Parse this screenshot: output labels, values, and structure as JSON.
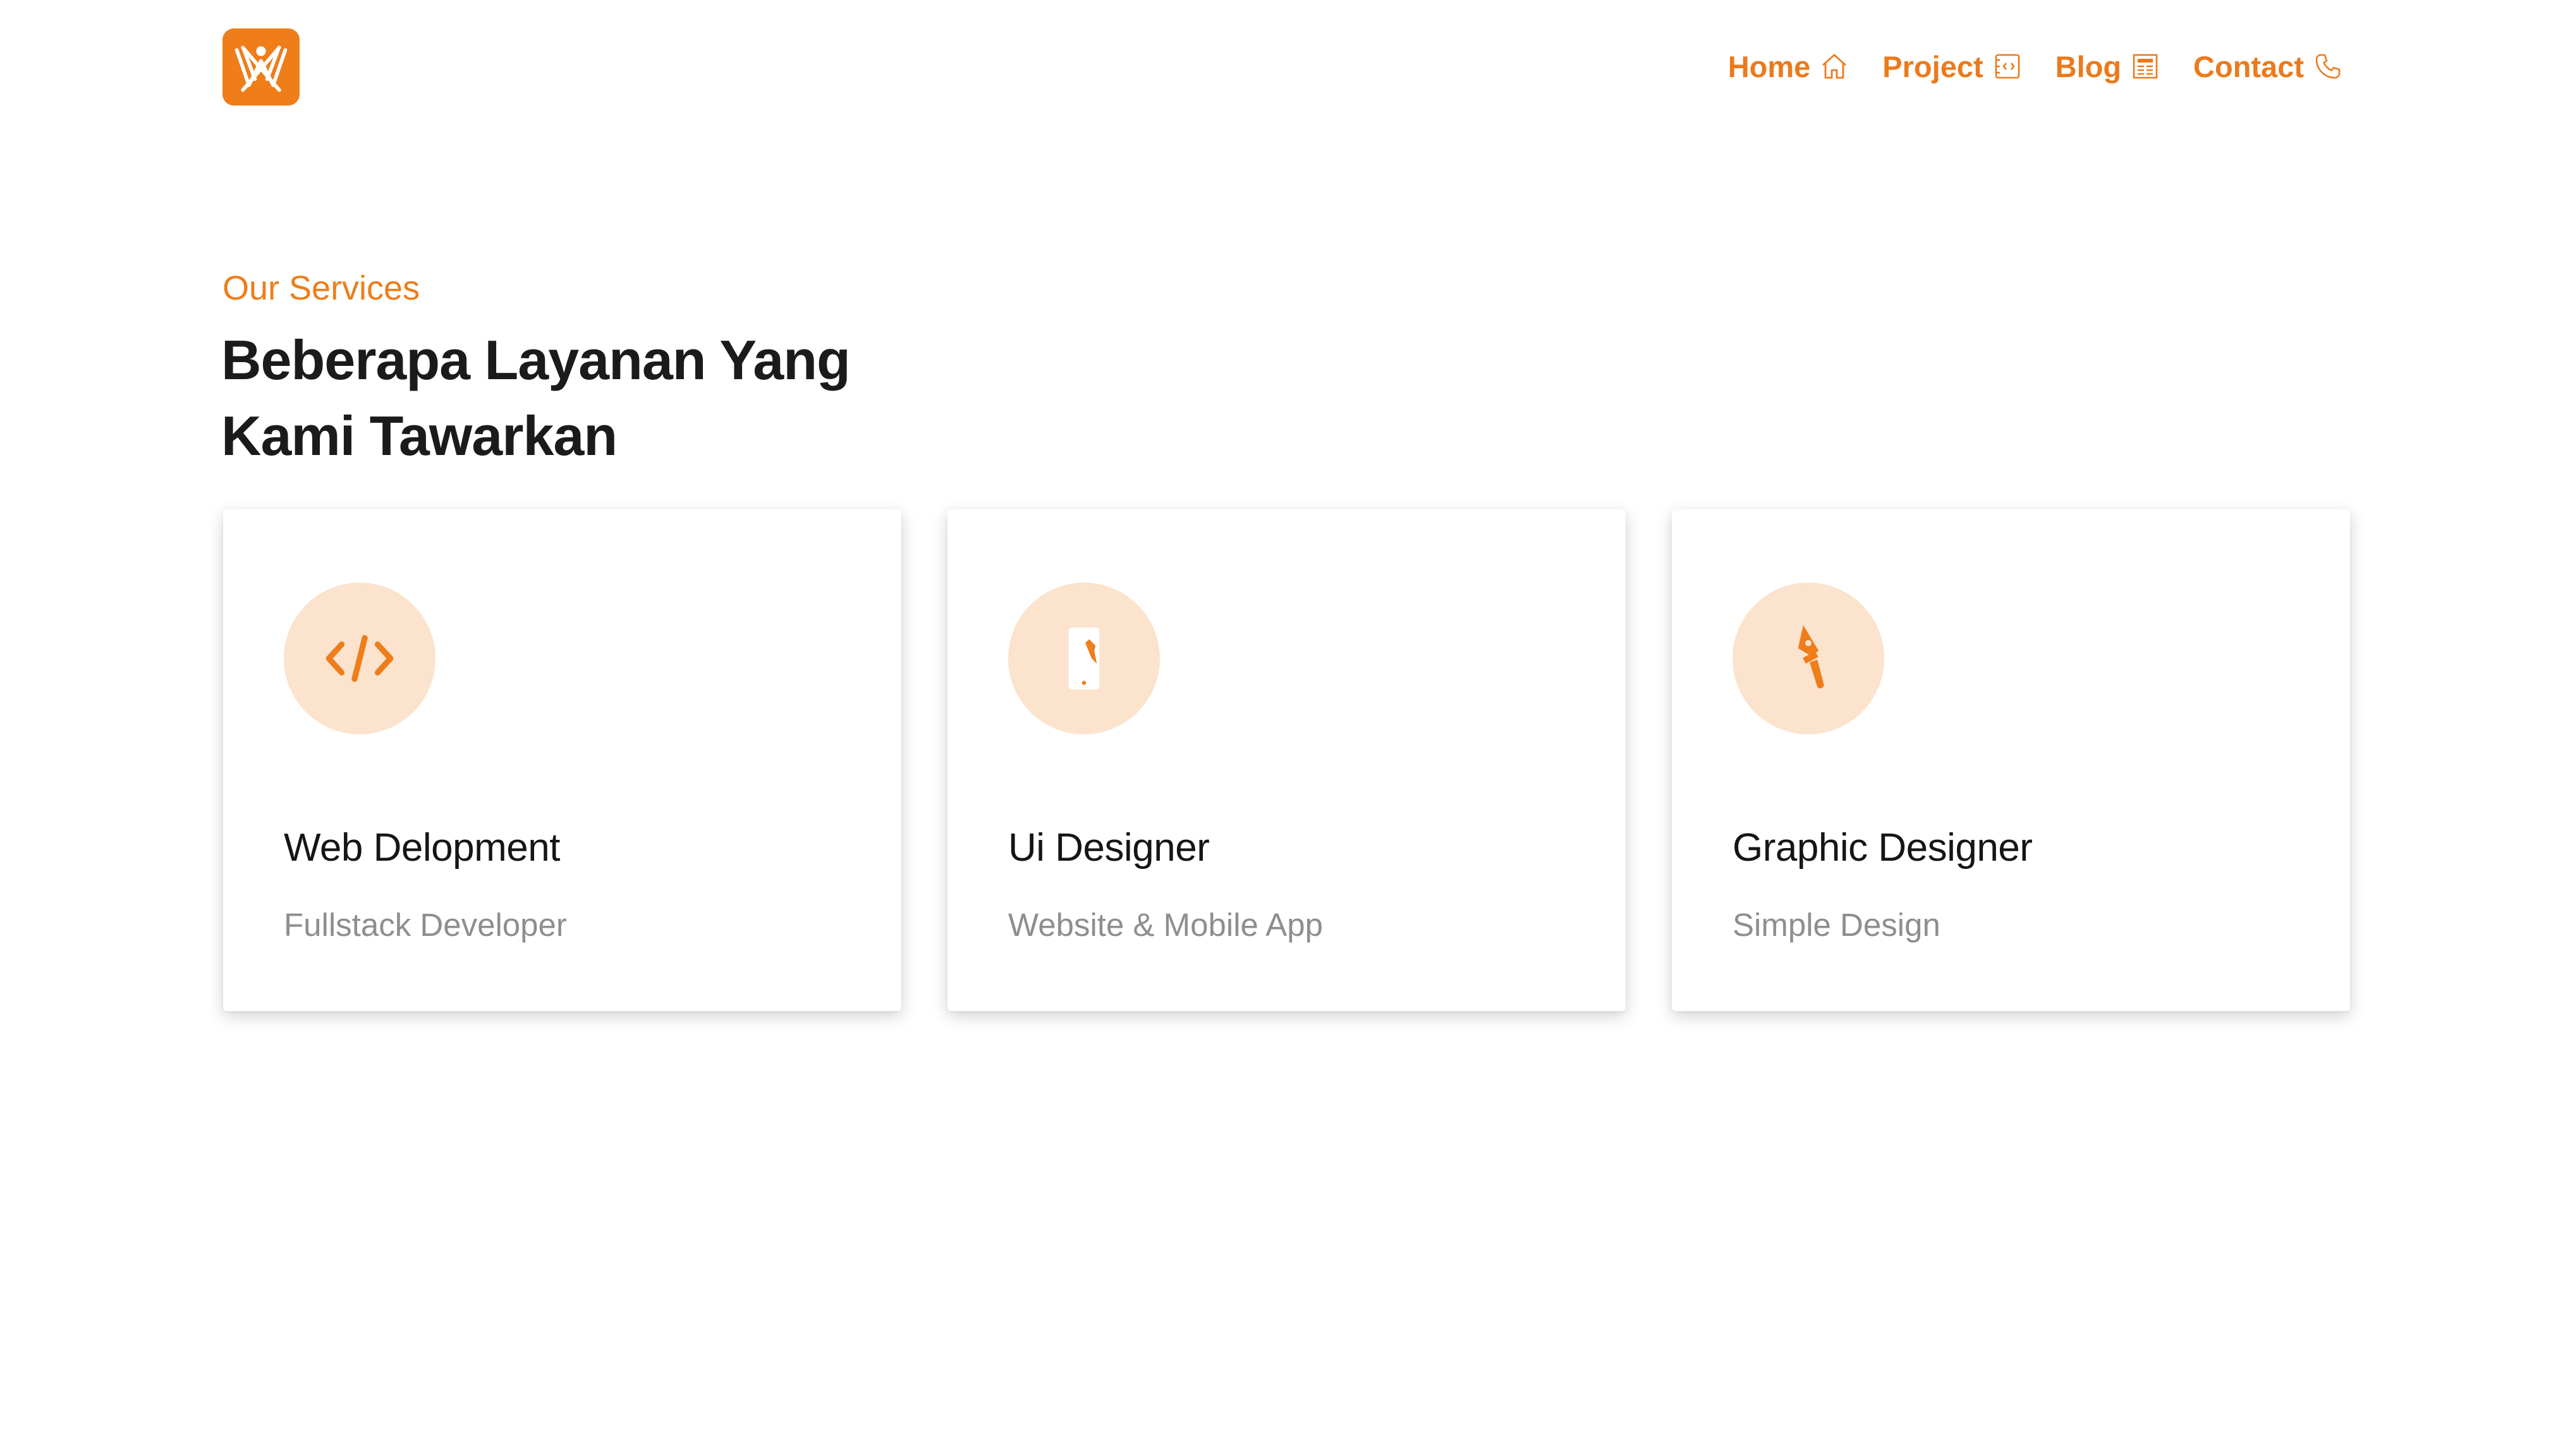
{
  "brand": {
    "logo_icon": "w-logo-icon",
    "accent_color": "#ee7d1a"
  },
  "nav": {
    "items": [
      {
        "label": "Home",
        "icon": "home-icon"
      },
      {
        "label": "Project",
        "icon": "code-window-icon"
      },
      {
        "label": "Blog",
        "icon": "newspaper-icon"
      },
      {
        "label": "Contact",
        "icon": "phone-icon"
      }
    ]
  },
  "services": {
    "eyebrow": "Our Services",
    "headline_line1": "Beberapa Layanan Yang",
    "headline_line2": "Kami Tawarkan",
    "cards": [
      {
        "title": "Web Delopment",
        "subtitle": "Fullstack Developer",
        "icon": "code-icon"
      },
      {
        "title": "Ui Designer",
        "subtitle": "Website & Mobile App",
        "icon": "mobile-pen-icon"
      },
      {
        "title": "Graphic Designer",
        "subtitle": "Simple Design",
        "icon": "pen-tool-icon"
      }
    ]
  }
}
